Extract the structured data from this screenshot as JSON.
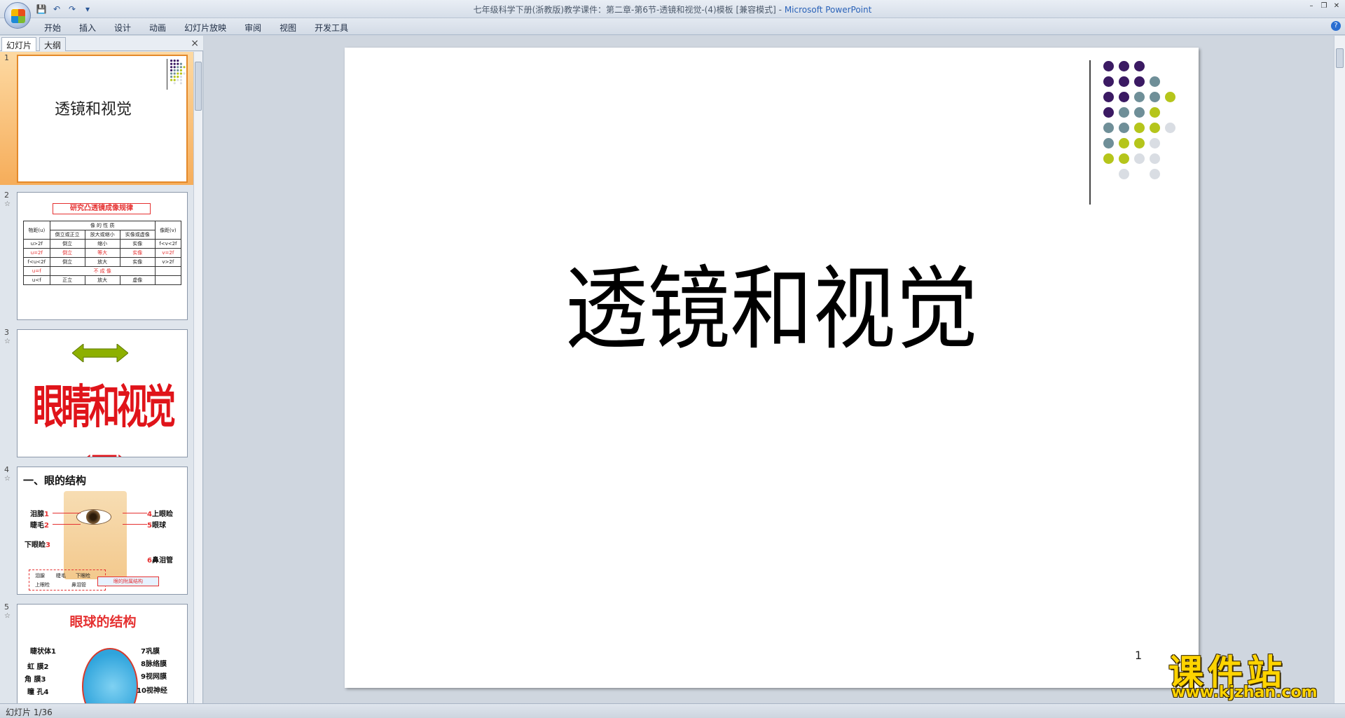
{
  "window": {
    "title": "七年级科学下册(浙教版)教学课件：第二章-第6节-透镜和视觉-(4)模板 [兼容模式]",
    "title_sep": " - ",
    "app_name": "Microsoft PowerPoint",
    "controls": [
      "minimize-icon",
      "restore-icon",
      "close-icon"
    ]
  },
  "quick_access": {
    "icons": [
      "save-icon",
      "undo-icon",
      "redo-icon",
      "customize-icon"
    ]
  },
  "ribbon": {
    "tabs": [
      "开始",
      "插入",
      "设计",
      "动画",
      "幻灯片放映",
      "审阅",
      "视图",
      "开发工具"
    ]
  },
  "left_pane": {
    "tabs": [
      "幻灯片",
      "大纲"
    ],
    "close": "×"
  },
  "thumbnails": {
    "t1": {
      "num": "1",
      "title": "透镜和视觉"
    },
    "t2": {
      "num": "2",
      "head": "研究凸透镜成像规律",
      "rows": [
        [
          "物距(u)",
          "像 的 性 质",
          "",
          "",
          "像距(v)"
        ],
        [
          "",
          "倒立或正立",
          "放大或缩小",
          "实像或虚像",
          ""
        ],
        [
          "u>2f",
          "倒立",
          "缩小",
          "实像",
          "f<v<2f"
        ],
        [
          "u=2f",
          "倒立",
          "等大",
          "实像",
          "v=2f"
        ],
        [
          "f<u<2f",
          "倒立",
          "放大",
          "实像",
          "v>2f"
        ],
        [
          "u=f",
          "不 成 像",
          "",
          "",
          ""
        ],
        [
          "u<f",
          "正立",
          "放大",
          "虚像",
          ""
        ]
      ]
    },
    "t3": {
      "num": "3",
      "title": "眼睛和视觉(三)"
    },
    "t4": {
      "num": "4",
      "title": "一、眼的结构",
      "labels": [
        "泪腺",
        "睫毛",
        "下眼睑",
        "上眼睑",
        "眼球",
        "鼻泪管"
      ],
      "nums": [
        "1",
        "2",
        "3",
        "4",
        "5",
        "6"
      ],
      "box1": [
        "泪腺",
        "睫毛",
        "下眼睑",
        "上眼睑",
        "鼻泪管"
      ],
      "box2": "眼的附属结构"
    },
    "t5": {
      "num": "5",
      "title": "眼球的结构",
      "labels": [
        "睫状体",
        "虹  膜",
        "角  膜",
        "瞳  孔",
        "巩膜",
        "脉络膜",
        "视网膜",
        "视神经"
      ],
      "nums": [
        "1",
        "2",
        "3",
        "4",
        "7",
        "8",
        "9",
        "10"
      ]
    }
  },
  "slide": {
    "title": "透镜和视觉",
    "page_number": "1",
    "dot_colors": {
      "purple": "#3b1a63",
      "teal": "#6f8f98",
      "lime": "#b5c51b",
      "light": "#d9dde3"
    }
  },
  "watermark": {
    "cn": "课件站",
    "url": "www.kjzhan.com"
  },
  "status": {
    "text": "幻灯片 1/36"
  }
}
